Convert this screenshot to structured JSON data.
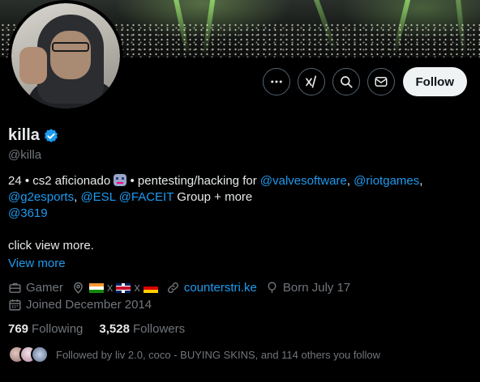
{
  "profile": {
    "name": "killa",
    "handle": "@killa",
    "verified": true
  },
  "actions": {
    "more_icon": "more-horizontal-icon",
    "grok_icon": "grok-icon",
    "search_icon": "search-icon",
    "message_icon": "envelope-icon",
    "follow_label": "Follow"
  },
  "bio": {
    "line1_prefix": "24 • cs2 aficionado ",
    "line1_mid": " • pentesting/hacking for ",
    "mention_valve": "@valvesoftware",
    "sep1": ", ",
    "mention_riot": "@riotgames",
    "sep2": ",",
    "mention_g2": "@g2esports",
    "sep3": ", ",
    "mention_esl": "@ESL",
    "sep4": " ",
    "mention_faceit": "@FACEIT",
    "line2_suffix": " Group + more",
    "mention_3619": "@3619",
    "line_extra": "click view more.",
    "view_more": "View more"
  },
  "meta": {
    "category": "Gamer",
    "location_sep1": "x",
    "location_sep2": "x",
    "website": "counterstri.ke",
    "birthday": "Born July 17",
    "joined": "Joined December 2014"
  },
  "stats": {
    "following_count": "769",
    "following_label": "Following",
    "followers_count": "3,528",
    "followers_label": "Followers"
  },
  "followed_by": {
    "text": "Followed by liv 2.0, coco - BUYING SKINS, and 114 others you follow"
  },
  "colors": {
    "link": "#1d9bf0",
    "muted": "#71767b",
    "text": "#e7e9ea",
    "verified": "#1d9bf0"
  }
}
